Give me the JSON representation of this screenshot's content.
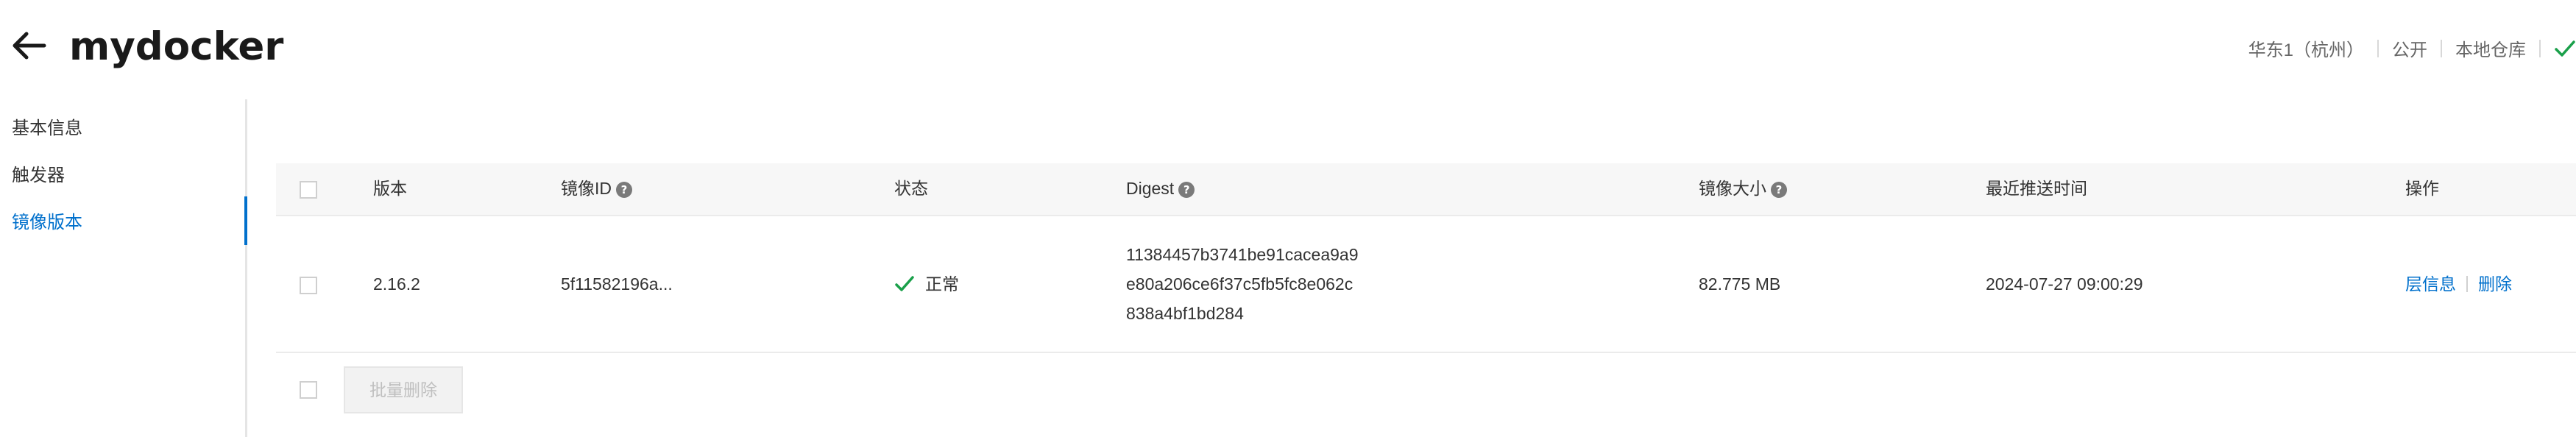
{
  "header": {
    "title": "mydocker",
    "region": "华东1（杭州）",
    "visibility": "公开",
    "repo_type": "本地仓库",
    "status_color": "#1aa04a"
  },
  "sidebar": {
    "items": [
      {
        "label": "基本信息",
        "active": false
      },
      {
        "label": "触发器",
        "active": false
      },
      {
        "label": "镜像版本",
        "active": true
      }
    ],
    "accent": "#0070cc"
  },
  "table": {
    "columns": {
      "version": "版本",
      "image_id": "镜像ID",
      "status": "状态",
      "digest": "Digest",
      "size": "镜像大小",
      "pushed": "最近推送时间",
      "actions": "操作"
    },
    "rows": [
      {
        "version": "2.16.2",
        "image_id": "5f11582196a...",
        "status": "正常",
        "digest_lines": [
          "11384457b3741be91cacea9a9",
          "e80a206ce6f37c5fb5fc8e062c",
          "838a4bf1bd284"
        ],
        "size": "82.775 MB",
        "pushed": "2024-07-27 09:00:29",
        "action_layers": "层信息",
        "action_delete": "删除"
      }
    ],
    "batch_delete": "批量删除"
  },
  "icons": {
    "back": "arrow-left-icon",
    "help": "question-circle-icon",
    "status_ok": "check-icon"
  },
  "help_glyph": "?"
}
